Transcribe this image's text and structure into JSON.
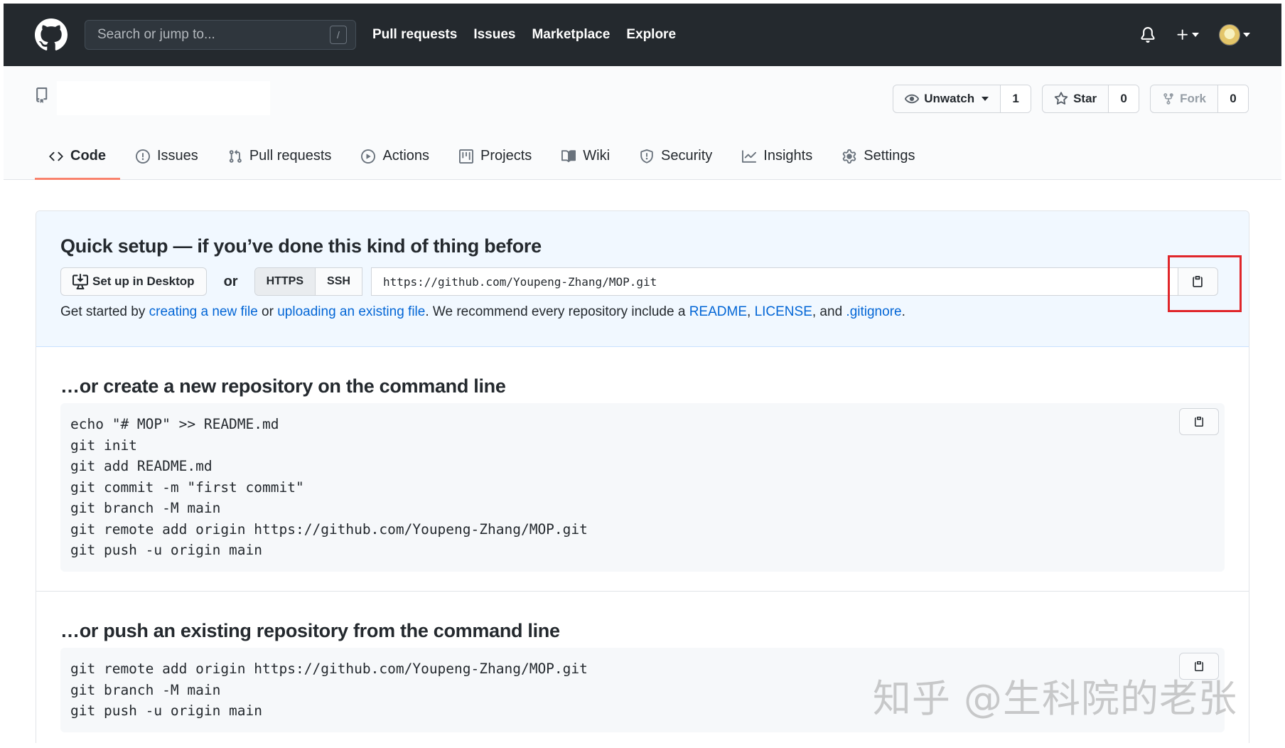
{
  "header": {
    "search_placeholder": "Search or jump to...",
    "search_shortcut": "/",
    "nav": [
      "Pull requests",
      "Issues",
      "Marketplace",
      "Explore"
    ]
  },
  "repo": {
    "actions": {
      "watch": {
        "label": "Unwatch",
        "count": "1"
      },
      "star": {
        "label": "Star",
        "count": "0"
      },
      "fork": {
        "label": "Fork",
        "count": "0"
      }
    },
    "tabs": [
      "Code",
      "Issues",
      "Pull requests",
      "Actions",
      "Projects",
      "Wiki",
      "Security",
      "Insights",
      "Settings"
    ],
    "active_tab": "Code"
  },
  "quick_setup": {
    "title": "Quick setup — if you’ve done this kind of thing before",
    "desktop_button": "Set up in Desktop",
    "or": "or",
    "protocols": [
      "HTTPS",
      "SSH"
    ],
    "selected_protocol": "HTTPS",
    "clone_url": "https://github.com/Youpeng-Zhang/MOP.git",
    "get_started": {
      "t1": "Get started by ",
      "link1": "creating a new file",
      "t2": " or ",
      "link2": "uploading an existing file",
      "t3": ". We recommend every repository include a ",
      "link3": "README",
      "t4": ", ",
      "link4": "LICENSE",
      "t5": ", and ",
      "link5": ".gitignore",
      "t6": "."
    }
  },
  "new_repo": {
    "title": "…or create a new repository on the command line",
    "commands": [
      "echo \"# MOP\" >> README.md",
      "git init",
      "git add README.md",
      "git commit -m \"first commit\"",
      "git branch -M main",
      "git remote add origin https://github.com/Youpeng-Zhang/MOP.git",
      "git push -u origin main"
    ]
  },
  "push_existing": {
    "title": "…or push an existing repository from the command line",
    "commands": [
      "git remote add origin https://github.com/Youpeng-Zhang/MOP.git",
      "git branch -M main",
      "git push -u origin main"
    ]
  },
  "watermark": "知乎 @生科院的老张",
  "colors": {
    "header_bg": "#24292e",
    "link": "#0366d6",
    "active_tab": "#f9826c",
    "highlight": "#e0262a"
  }
}
